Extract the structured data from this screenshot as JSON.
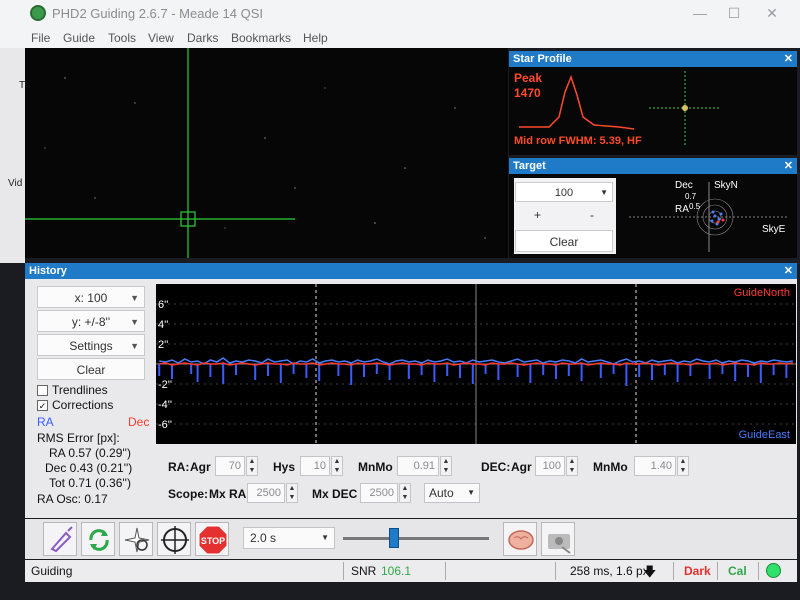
{
  "window": {
    "title": "PHD2 Guiding 2.6.7 - Meade 14 QSI"
  },
  "menu": [
    "File",
    "Guide",
    "Tools",
    "View",
    "Darks",
    "Bookmarks",
    "Help"
  ],
  "left_strip": {
    "labels": [
      "T",
      "Vid"
    ]
  },
  "star_profile": {
    "title": "Star Profile",
    "peak_label": "Peak",
    "peak_value": "1470",
    "fwhm_text": "Mid row FWHM: 5.39, HF"
  },
  "target": {
    "title": "Target",
    "zoom_value": "100",
    "plus_label": "+",
    "minus_label": "-",
    "clear_label": "Clear",
    "label_dec": "Dec",
    "label_ra": "RA",
    "label_skyn": "SkyN",
    "label_skye": "SkyE",
    "ring_labels": [
      "0.7",
      "0.5"
    ]
  },
  "history": {
    "title": "History",
    "x_select": "x: 100",
    "y_select": "y: +/-8''",
    "settings_label": "Settings",
    "clear_label": "Clear",
    "trendlines_label": "Trendlines",
    "trendlines_checked": false,
    "corrections_label": "Corrections",
    "corrections_checked": true,
    "legend_ra": "RA",
    "legend_dec": "Dec",
    "rms_title": "RMS Error [px]:",
    "rms_ra": "RA  0.57 (0.29'')",
    "rms_dec": "Dec  0.43 (0.21'')",
    "rms_tot": "Tot  0.71 (0.36'')",
    "ra_osc": "RA Osc: 0.17",
    "graph_top_right": "GuideNorth",
    "graph_bottom_right": "GuideEast"
  },
  "params": {
    "ra_label": "RA:",
    "agr_label": "Agr",
    "ra_agr": "70",
    "hys_label": "Hys",
    "ra_hys": "10",
    "mnmo_label": "MnMo",
    "ra_mnmo": "0.91",
    "dec_label": "DEC:",
    "dec_agr": "100",
    "dec_mnmo": "1.40",
    "scope_label": "Scope:",
    "mxra_label": "Mx RA",
    "mx_ra": "2500",
    "mxdec_label": "Mx DEC",
    "mx_dec": "2500",
    "dec_mode": "Auto"
  },
  "toolbar": {
    "exposure": "2.0 s",
    "exposure_slider_fraction": 0.35
  },
  "status": {
    "state": "Guiding",
    "snr_label": "SNR",
    "snr_value": "106.1",
    "timing": "258 ms, 1.6 px",
    "dark_label": "Dark",
    "cal_label": "Cal"
  },
  "colors": {
    "ra_color": "#4a7cff",
    "dec_color": "#ff3b30",
    "panel_header": "#1f7ac8",
    "star_profile_red": "#ff4a2a",
    "snr_green": "#2fe06a"
  },
  "chart_data": {
    "type": "line",
    "title": "",
    "xlabel": "",
    "ylabel": "",
    "ylim": [
      -8,
      8
    ],
    "y_ticks": [
      "6''",
      "4''",
      "2''",
      "-2''",
      "-4''",
      "-6''"
    ],
    "x_range_points": 100,
    "grid": true,
    "series": [
      {
        "name": "RA",
        "color": "#4a7cff",
        "values": [
          0.3,
          0.2,
          0.4,
          0.1,
          0.5,
          0.2,
          0.3,
          0.0,
          0.4,
          0.2,
          0.6,
          0.1,
          0.3,
          0.2,
          0.4,
          0.3,
          0.1,
          0.5,
          0.2,
          0.3,
          0.4,
          0.0,
          0.3,
          0.2,
          0.5,
          0.1,
          0.3,
          0.4,
          0.2,
          0.3,
          0.1,
          0.4,
          0.2,
          0.3,
          0.5,
          0.2,
          0.0,
          0.3,
          0.4,
          0.2,
          0.3,
          0.1,
          0.4,
          0.2,
          0.3,
          0.5,
          0.2,
          0.3,
          0.1,
          0.4,
          0.2,
          0.3,
          0.4,
          0.2,
          0.1,
          0.3,
          0.5,
          0.2,
          0.3,
          0.4,
          0.1,
          0.3,
          0.2,
          0.4,
          0.3,
          0.1,
          0.5,
          0.2,
          0.3,
          0.4,
          0.2,
          0.0,
          0.3,
          0.5,
          0.2,
          0.3,
          0.1,
          0.4,
          0.2,
          0.3,
          0.4,
          0.1,
          0.3,
          0.2,
          0.5,
          0.3,
          0.2,
          0.4,
          0.1,
          0.3,
          0.2,
          0.4,
          0.3,
          0.1,
          0.3,
          0.2,
          0.4,
          0.3,
          0.2,
          0.3
        ]
      },
      {
        "name": "Dec",
        "color": "#ff3b30",
        "values": [
          0.0,
          0.1,
          -0.1,
          0.0,
          0.1,
          0.0,
          -0.1,
          0.1,
          0.0,
          0.0,
          0.1,
          -0.1,
          0.0,
          0.1,
          0.0,
          -0.1,
          0.0,
          0.1,
          0.0,
          0.0,
          -0.1,
          0.1,
          0.0,
          0.0,
          0.1,
          -0.1,
          0.0,
          0.1,
          0.0,
          0.0,
          -0.1,
          0.1,
          0.0,
          0.0,
          0.1,
          0.0,
          -0.1,
          0.0,
          0.1,
          0.0,
          0.0,
          -0.1,
          0.1,
          0.0,
          0.0,
          0.1,
          -0.1,
          0.0,
          0.1,
          0.0,
          0.0,
          -0.1,
          0.1,
          0.0,
          0.0,
          0.1,
          0.0,
          -0.1,
          0.0,
          0.1,
          0.0,
          0.0,
          -0.1,
          0.1,
          0.0,
          0.0,
          0.1,
          -0.1,
          0.0,
          0.1,
          0.0,
          0.0,
          -0.1,
          0.1,
          0.0,
          0.0,
          0.1,
          0.0,
          -0.1,
          0.0,
          0.1,
          0.0,
          0.0,
          -0.1,
          0.1,
          0.0,
          0.0,
          0.1,
          -0.1,
          0.0,
          0.1,
          0.0,
          0.0,
          -0.1,
          0.1,
          0.0,
          0.0,
          0.1,
          0.0,
          0.1
        ]
      },
      {
        "name": "RA corrections",
        "color": "#3a5cff",
        "values": [
          -1.2,
          0,
          -1.5,
          0,
          0,
          -1.0,
          -1.8,
          0,
          -1.3,
          0,
          -2.0,
          0,
          -1.1,
          0,
          0,
          -1.6,
          0,
          -1.2,
          0,
          -1.9,
          0,
          -1.0,
          0,
          -1.4,
          0,
          -1.7,
          0,
          0,
          -1.2,
          0,
          -2.1,
          0,
          -1.3,
          0,
          -1.0,
          0,
          -1.6,
          0,
          0,
          -1.5,
          0,
          -1.1,
          0,
          -1.8,
          0,
          -1.2,
          0,
          -1.4,
          0,
          -2.0,
          0,
          -1.0,
          0,
          -1.6,
          0,
          0,
          -1.3,
          0,
          -1.9,
          0,
          -1.1,
          0,
          -1.5,
          0,
          -1.2,
          0,
          -1.7,
          0,
          0,
          -1.4,
          0,
          -1.0,
          0,
          -2.2,
          0,
          -1.3,
          0,
          -1.6,
          0,
          -1.1,
          0,
          -1.8,
          0,
          -1.2,
          0,
          0,
          -1.5,
          0,
          -1.0,
          0,
          -1.7,
          0,
          -1.3,
          0,
          -1.9,
          0,
          -1.1,
          0,
          -1.4,
          0
        ]
      }
    ]
  }
}
